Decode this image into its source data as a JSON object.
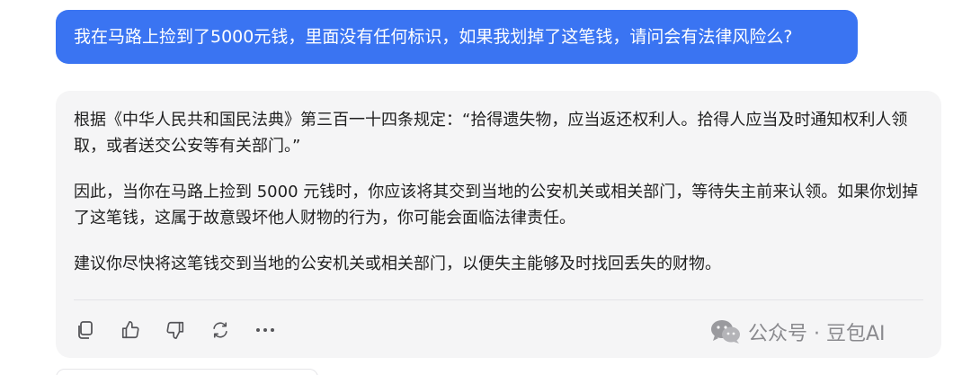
{
  "user_message": {
    "text": "我在马路上捡到了5000元钱，里面没有任何标识，如果我划掉了这笔钱，请问会有法律风险么?"
  },
  "answer": {
    "paragraphs": [
      "根据《中华人民共和国民法典》第三百一十四条规定：“拾得遗失物，应当返还权利人。拾得人应当及时通知权利人领取，或者送交公安等有关部门。”",
      "因此，当你在马路上捡到 5000 元钱时，你应该将其交到当地的公安机关或相关部门，等待失主前来认领。如果你划掉了这笔钱，这属于故意毁坏他人财物的行为，你可能会面临法律责任。",
      "建议你尽快将这笔钱交到当地的公安机关或相关部门，以便失主能够及时找回丢失的财物。"
    ]
  },
  "actions": {
    "icons": [
      "copy-icon",
      "thumbs-up-icon",
      "thumbs-down-icon",
      "regenerate-icon",
      "more-icon"
    ]
  },
  "watermark": {
    "text": "公众号 · 豆包AI"
  },
  "colors": {
    "user_bubble": "#3a74f2",
    "card_background": "#f5f5f6",
    "icon": "#555559"
  }
}
